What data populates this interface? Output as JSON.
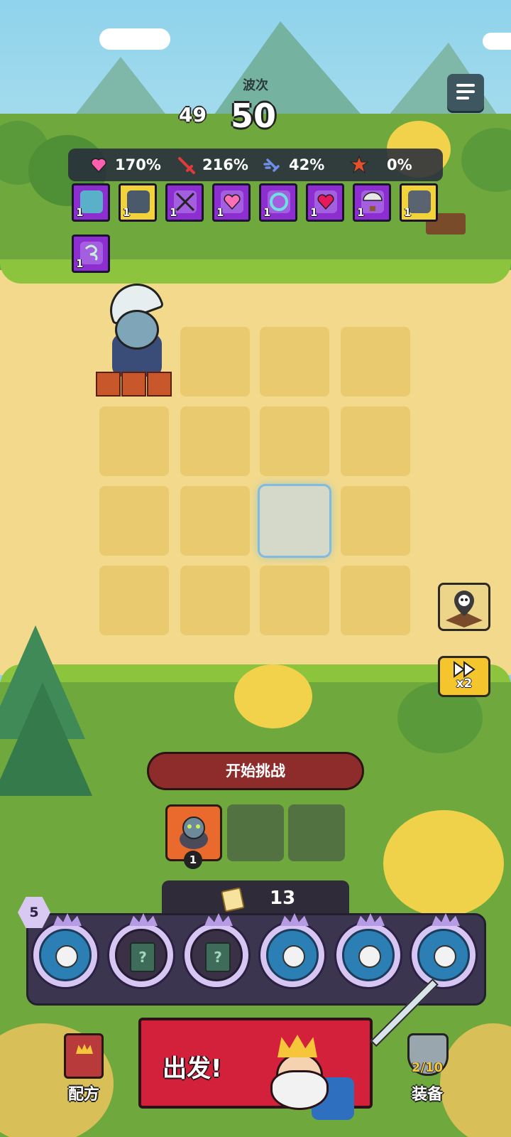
{
  "wave": {
    "label": "波次",
    "previous": "49",
    "current": "50"
  },
  "stats": [
    {
      "icon": "heart-icon",
      "value": "170%",
      "color": "#ff5fb0"
    },
    {
      "icon": "sword-icon",
      "value": "216%",
      "color": "#e23a3a"
    },
    {
      "icon": "speed-sword-icon",
      "value": "42%",
      "color": "#6e8ee8"
    },
    {
      "icon": "crit-burst-icon",
      "value": "0%",
      "color": "#e2502c"
    }
  ],
  "cards": [
    {
      "icon": "turret-card-icon",
      "count": "1",
      "rarity": "purple"
    },
    {
      "icon": "treasure-tower-card-icon",
      "count": "1",
      "rarity": "gold"
    },
    {
      "icon": "crossed-swords-card-icon",
      "count": "1",
      "rarity": "purple"
    },
    {
      "icon": "heart-flower-card-icon",
      "count": "1",
      "rarity": "purple"
    },
    {
      "icon": "ring-card-icon",
      "count": "1",
      "rarity": "purple"
    },
    {
      "icon": "heart-burst-card-icon",
      "count": "1",
      "rarity": "purple"
    },
    {
      "icon": "parachute-card-icon",
      "count": "1",
      "rarity": "purple"
    },
    {
      "icon": "skull-altar-card-icon",
      "count": "1",
      "rarity": "gold"
    },
    {
      "icon": "whirlwind-card-icon",
      "count": "1",
      "rarity": "purple"
    }
  ],
  "challenge_button": "开始挑战",
  "queue": {
    "count": "1"
  },
  "speed_button": "x2",
  "currency": {
    "value": "13"
  },
  "team": {
    "level": "5",
    "slots": [
      "hero",
      "locked",
      "locked",
      "hero",
      "hero",
      "hero"
    ]
  },
  "bottom_nav": {
    "recipe": "配方",
    "go": "出发!",
    "equipment": "装备",
    "equipment_count": "2/10"
  }
}
